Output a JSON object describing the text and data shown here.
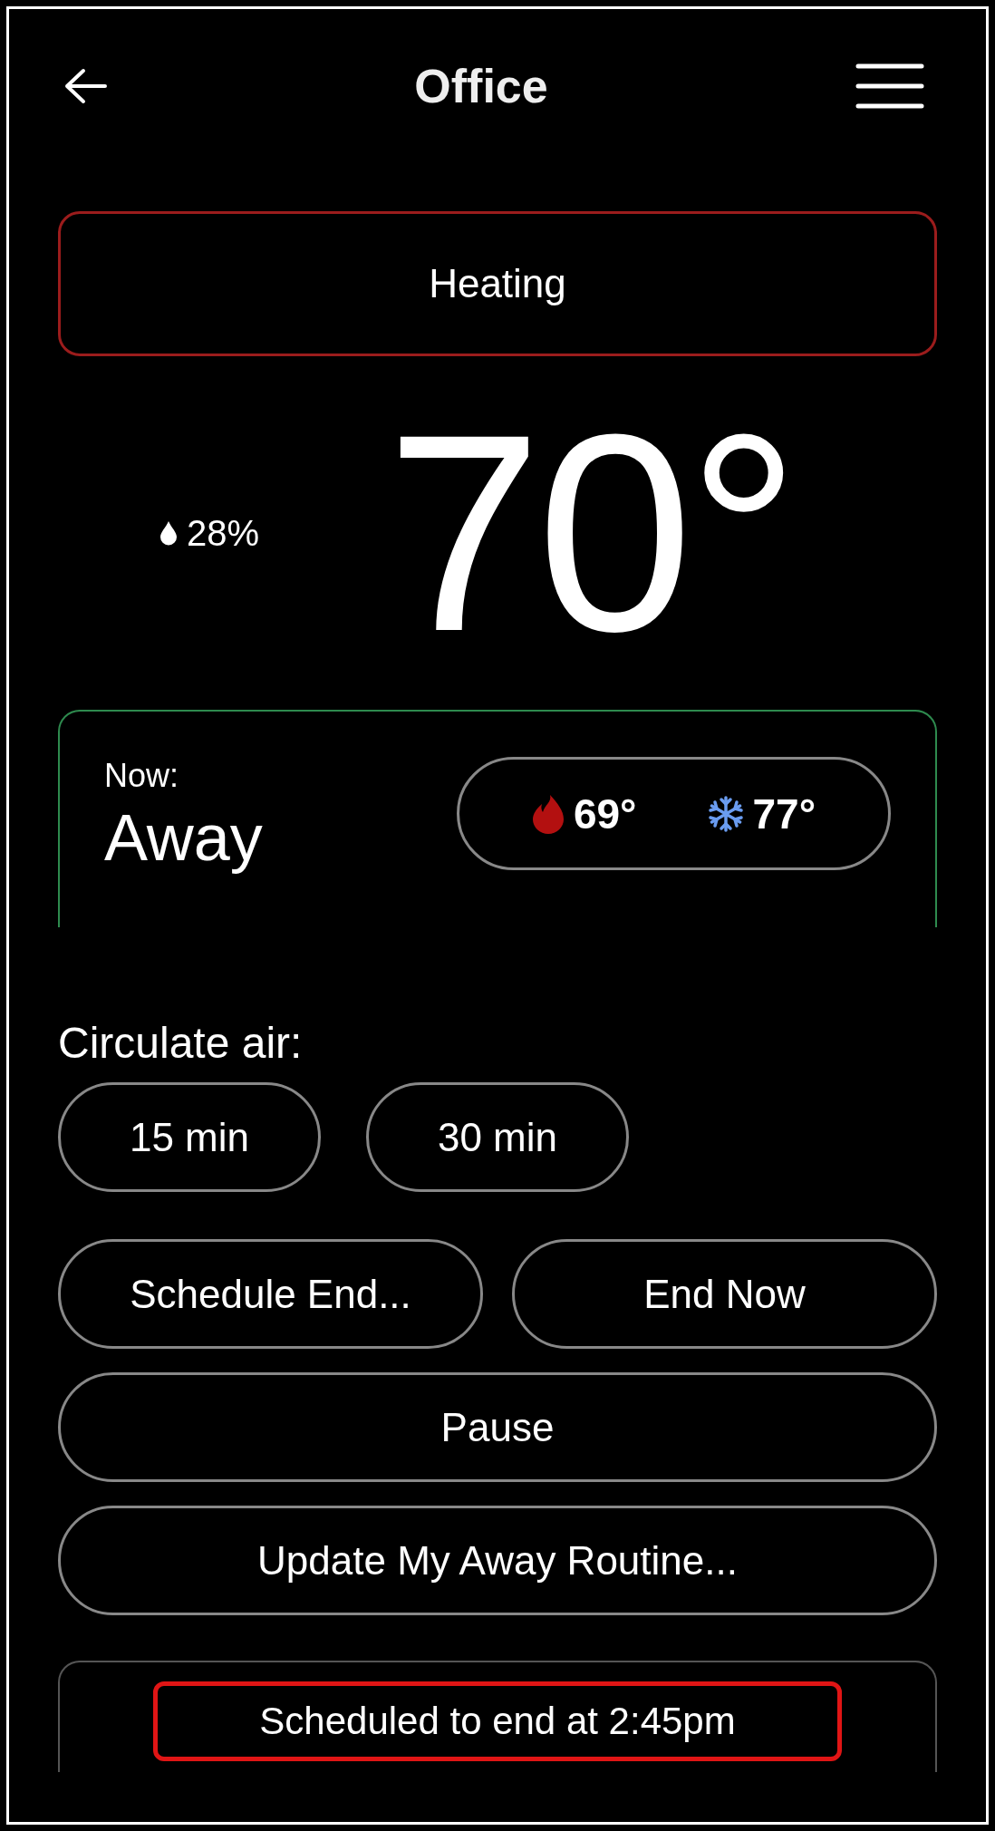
{
  "header": {
    "title": "Office"
  },
  "status": {
    "label": "Heating",
    "kind": "heating"
  },
  "humidity": "28%",
  "temperature": "70°",
  "mode_card": {
    "caption": "Now:",
    "mode": "Away",
    "setpoints": [
      {
        "kind": "heat",
        "value": "69°"
      },
      {
        "kind": "cool",
        "value": "77°"
      }
    ]
  },
  "circulate": {
    "label": "Circulate air:",
    "options": [
      "15 min",
      "30 min"
    ]
  },
  "actions": [
    {
      "label": "Schedule End...",
      "kind": "half"
    },
    {
      "label": "End Now",
      "kind": "half"
    },
    {
      "label": "Pause",
      "kind": "full"
    },
    {
      "label": "Update My Away Routine...",
      "kind": "full"
    }
  ],
  "notice": "Scheduled to end at 2:45pm"
}
